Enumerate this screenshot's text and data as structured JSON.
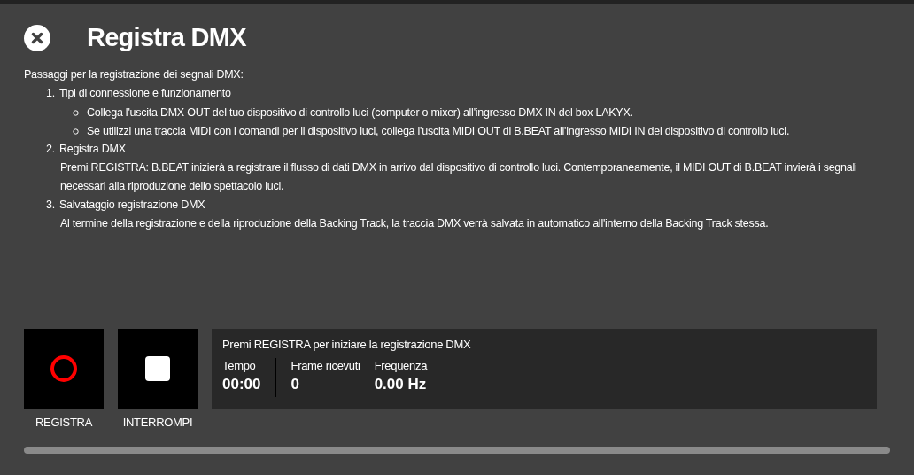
{
  "title": "Registra DMX",
  "intro": "Passaggi per la registrazione dei segnali DMX:",
  "steps": [
    {
      "number": "1.",
      "title": "Tipi di connessione e funzionamento",
      "kind": "bullets",
      "items": [
        "Collega l'uscita DMX OUT del tuo dispositivo di controllo luci (computer o mixer) all'ingresso DMX IN del box LAKYX.",
        "Se utilizzi una traccia MIDI con i comandi per il dispositivo luci, collega l'uscita MIDI OUT di B.BEAT all'ingresso MIDI IN del dispositivo di controllo luci."
      ]
    },
    {
      "number": "2.",
      "title": "Registra DMX",
      "kind": "paragraph",
      "text": "Premi REGISTRA: B.BEAT inizierà a registrare il flusso di dati DMX in arrivo dal dispositivo di controllo luci. Contemporaneamente, il MIDI OUT di B.BEAT invierà i segnali necessari alla riproduzione dello spettacolo luci."
    },
    {
      "number": "3.",
      "title": "Salvataggio registrazione DMX",
      "kind": "paragraph",
      "text": "Al termine della registrazione e della riproduzione della Backing Track, la traccia DMX verrà salvata in automatico all'interno della Backing Track stessa."
    }
  ],
  "controls": [
    {
      "kind": "record",
      "label": "REGISTRA"
    },
    {
      "kind": "stop",
      "label": "INTERROMPI"
    }
  ],
  "status": {
    "message": "Premi REGISTRA per iniziare la registrazione DMX",
    "stats": [
      {
        "label": "Tempo",
        "value": "00:00"
      },
      {
        "label": "Frame ricevuti",
        "value": "0"
      },
      {
        "label": "Frequenza",
        "value": "0.00 Hz"
      }
    ]
  }
}
